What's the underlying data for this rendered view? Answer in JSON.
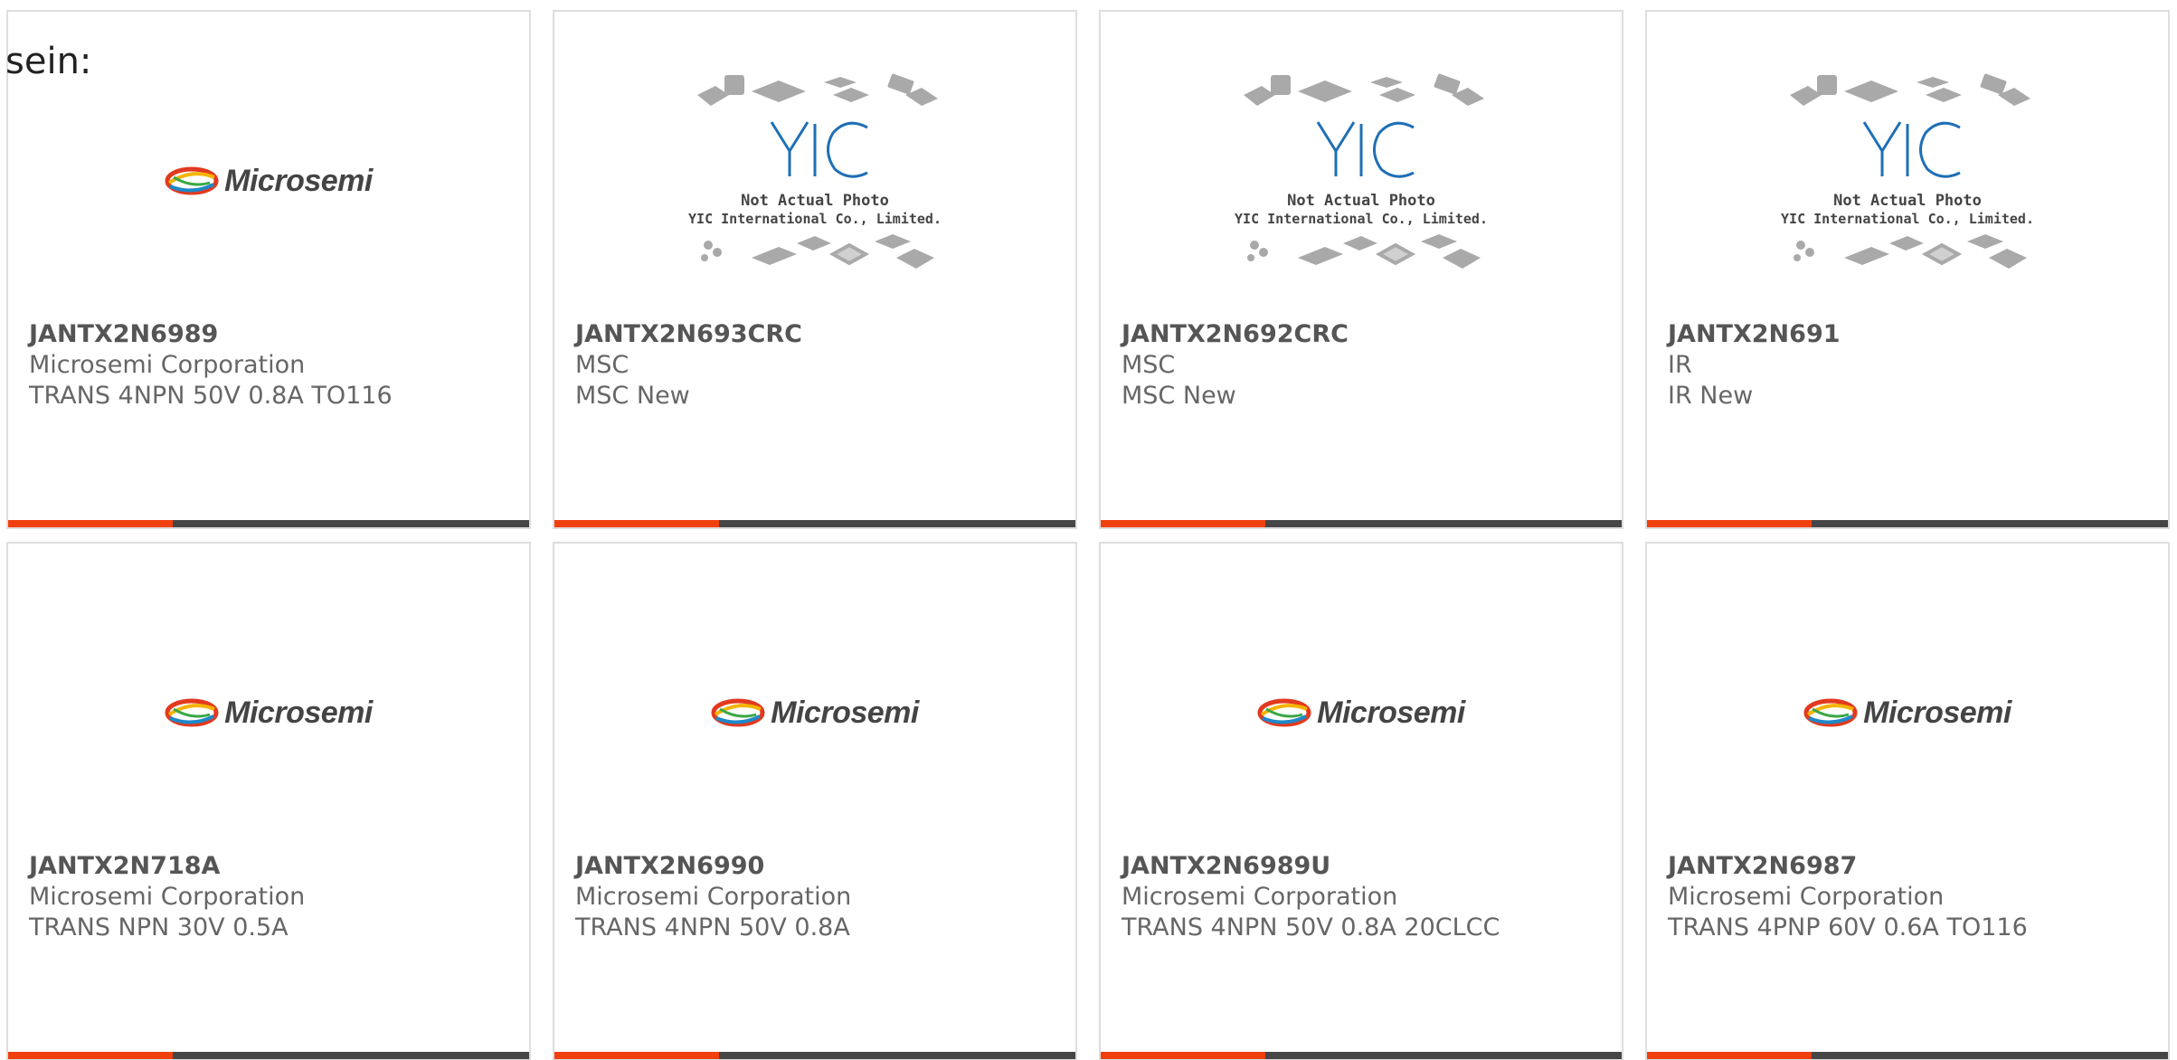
{
  "lead_text": "sein:",
  "colors": {
    "accent": "#f0400e",
    "bar": "#464646",
    "border": "#dedede",
    "text": "#666666"
  },
  "cards": [
    {
      "image": "microsemi-logo",
      "logo_text": "Microsemi",
      "part": "JANTX2N6989",
      "maker": "Microsemi Corporation",
      "desc": "TRANS 4NPN 50V 0.8A TO116"
    },
    {
      "image": "yic-placeholder",
      "photo_note_1": "Not Actual Photo",
      "photo_note_2": "YIC International Co., Limited.",
      "part": "JANTX2N693CRC",
      "maker": "MSC",
      "desc": "MSC New"
    },
    {
      "image": "yic-placeholder",
      "photo_note_1": "Not Actual Photo",
      "photo_note_2": "YIC International Co., Limited.",
      "part": "JANTX2N692CRC",
      "maker": "MSC",
      "desc": "MSC New"
    },
    {
      "image": "yic-placeholder",
      "photo_note_1": "Not Actual Photo",
      "photo_note_2": "YIC International Co., Limited.",
      "part": "JANTX2N691",
      "maker": "IR",
      "desc": "IR New"
    },
    {
      "image": "microsemi-logo",
      "logo_text": "Microsemi",
      "part": "JANTX2N718A",
      "maker": "Microsemi Corporation",
      "desc": "TRANS NPN 30V 0.5A"
    },
    {
      "image": "microsemi-logo",
      "logo_text": "Microsemi",
      "part": "JANTX2N6990",
      "maker": "Microsemi Corporation",
      "desc": "TRANS 4NPN 50V 0.8A"
    },
    {
      "image": "microsemi-logo",
      "logo_text": "Microsemi",
      "part": "JANTX2N6989U",
      "maker": "Microsemi Corporation",
      "desc": "TRANS 4NPN 50V 0.8A 20CLCC"
    },
    {
      "image": "microsemi-logo",
      "logo_text": "Microsemi",
      "part": "JANTX2N6987",
      "maker": "Microsemi Corporation",
      "desc": "TRANS 4PNP 60V 0.6A TO116"
    }
  ]
}
